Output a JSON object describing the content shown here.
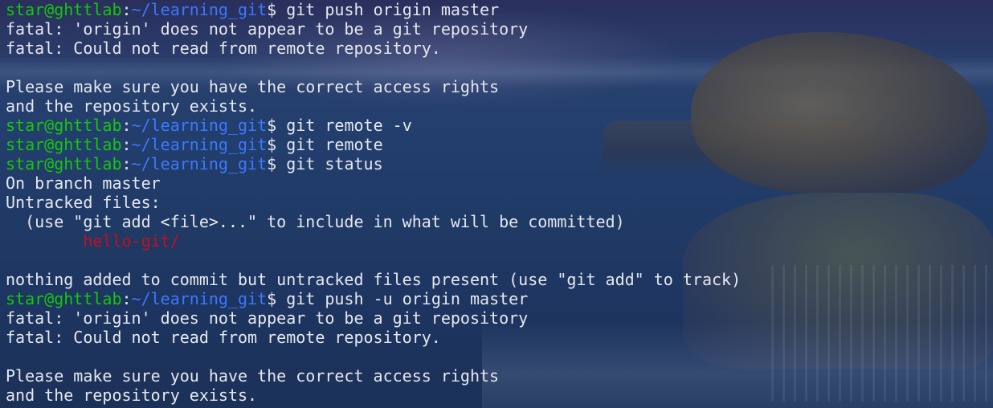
{
  "prompt": {
    "user_host": "star@ghttlab",
    "separator": ":",
    "path": "~/learning_git",
    "dollar": "$"
  },
  "lines": [
    {
      "type": "prompt",
      "command": " git push origin master"
    },
    {
      "type": "output",
      "text": "fatal: 'origin' does not appear to be a git repository"
    },
    {
      "type": "output",
      "text": "fatal: Could not read from remote repository."
    },
    {
      "type": "output",
      "text": ""
    },
    {
      "type": "output",
      "text": "Please make sure you have the correct access rights"
    },
    {
      "type": "output",
      "text": "and the repository exists."
    },
    {
      "type": "prompt",
      "command": " git remote -v"
    },
    {
      "type": "prompt",
      "command": " git remote"
    },
    {
      "type": "prompt",
      "command": " git status"
    },
    {
      "type": "output",
      "text": "On branch master"
    },
    {
      "type": "output",
      "text": "Untracked files:"
    },
    {
      "type": "output",
      "text": "  (use \"git add <file>...\" to include in what will be committed)"
    },
    {
      "type": "untracked",
      "text": "        hello-git/"
    },
    {
      "type": "output",
      "text": ""
    },
    {
      "type": "output",
      "text": "nothing added to commit but untracked files present (use \"git add\" to track)"
    },
    {
      "type": "prompt",
      "command": " git push -u origin master"
    },
    {
      "type": "output",
      "text": "fatal: 'origin' does not appear to be a git repository"
    },
    {
      "type": "output",
      "text": "fatal: Could not read from remote repository."
    },
    {
      "type": "output",
      "text": ""
    },
    {
      "type": "output",
      "text": "Please make sure you have the correct access rights"
    },
    {
      "type": "output",
      "text": "and the repository exists."
    }
  ],
  "colors": {
    "user_host": "#16c60c",
    "path": "#3b78ff",
    "untracked": "#c50f1f",
    "text": "#e6e8ee"
  }
}
